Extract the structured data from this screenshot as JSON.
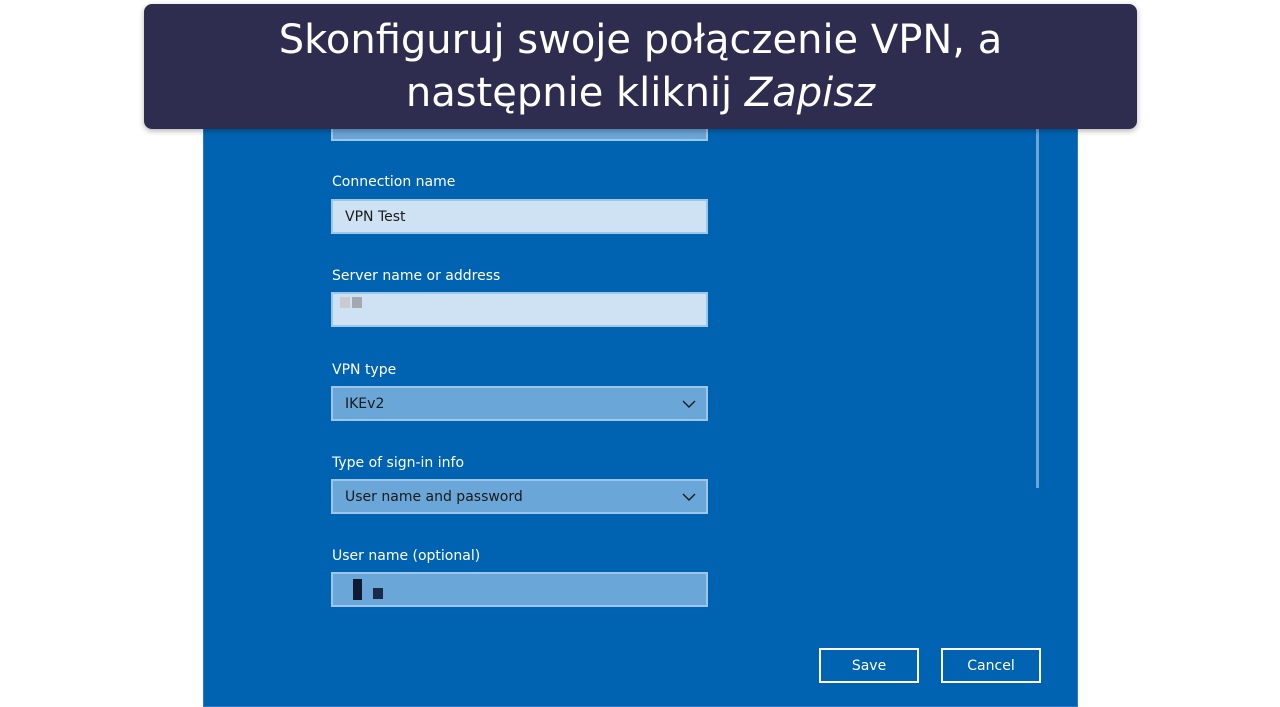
{
  "banner": {
    "line1": "Skonfiguruj swoje połączenie VPN, a",
    "line2_prefix": "następnie kliknij ",
    "line2_emphasis": "Zapisz"
  },
  "form": {
    "connection_name": {
      "label": "Connection name",
      "value": "VPN Test"
    },
    "server": {
      "label": "Server name or address",
      "value": ""
    },
    "vpn_type": {
      "label": "VPN type",
      "value": "IKEv2"
    },
    "sign_in": {
      "label": "Type of sign-in info",
      "value": "User name and password"
    },
    "user_name": {
      "label": "User name (optional)",
      "value": ""
    }
  },
  "buttons": {
    "save": "Save",
    "cancel": "Cancel"
  },
  "colors": {
    "dialog_bg": "#0063b1",
    "banner_bg": "#2e2d4f",
    "field_light": "#cfe2f3",
    "field_mid": "#6aa6d8"
  },
  "icons": {
    "dropdown": "chevron-down-icon"
  }
}
